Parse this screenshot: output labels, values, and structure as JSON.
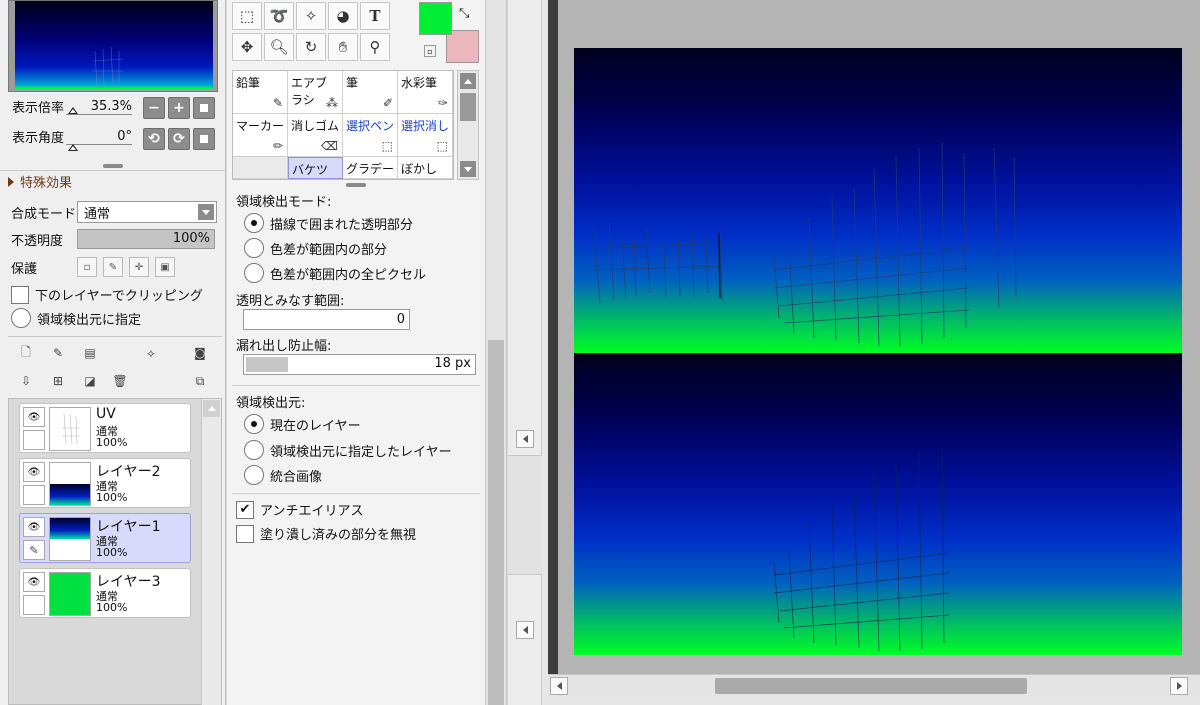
{
  "navigator": {
    "zoom_label": "表示倍率",
    "zoom_value": "35.3%",
    "angle_label": "表示角度",
    "angle_value": "0°",
    "zoom_buttons": [
      "−",
      "+",
      ""
    ],
    "angle_buttons": [
      "⟲",
      "⟳",
      ""
    ]
  },
  "effects": {
    "header": "特殊効果"
  },
  "layer_props": {
    "blend_label": "合成モード",
    "blend_value": "通常",
    "opacity_label": "不透明度",
    "opacity_value": "100%",
    "opacity_fraction": 1.0,
    "protect_label": "保護",
    "clip_label": "下のレイヤーでクリッピング",
    "clip_checked": false,
    "detect_source_label": "領域検出元に指定",
    "detect_source_checked": false
  },
  "layers": [
    {
      "name": "UV",
      "mode": "通常",
      "opacity": "100%",
      "visible": true,
      "selected": false,
      "thumb": "sketch"
    },
    {
      "name": "レイヤー2",
      "mode": "通常",
      "opacity": "100%",
      "visible": true,
      "selected": false,
      "thumb": "gradient-bottom"
    },
    {
      "name": "レイヤー1",
      "mode": "通常",
      "opacity": "100%",
      "visible": true,
      "selected": true,
      "thumb": "gradient-top"
    },
    {
      "name": "レイヤー3",
      "mode": "通常",
      "opacity": "100%",
      "visible": true,
      "selected": false,
      "thumb": "green"
    }
  ],
  "tools": {
    "row1": [
      "rect-select-icon",
      "lasso-icon",
      "magic-wand-icon",
      "select-pen-icon",
      "text-icon"
    ],
    "row2": [
      "move-icon",
      "zoom-icon",
      "rotate-icon",
      "hand-icon",
      "eyedropper-icon"
    ],
    "text_tool_glyph": "T"
  },
  "colors": {
    "main": "#00ee33",
    "sub": "#ebb6bd"
  },
  "brushes": [
    {
      "label": "鉛筆",
      "color": "normal"
    },
    {
      "label": "エアブラシ",
      "color": "normal"
    },
    {
      "label": "筆",
      "color": "normal"
    },
    {
      "label": "水彩筆",
      "color": "normal"
    },
    {
      "label": "マーカー",
      "color": "normal"
    },
    {
      "label": "消しゴム",
      "color": "normal"
    },
    {
      "label": "選択ペン",
      "color": "blue"
    },
    {
      "label": "選択消し",
      "color": "blue"
    },
    {
      "label": "",
      "color": "normal"
    },
    {
      "label": "バケツ",
      "color": "normal"
    },
    {
      "label": "グラデー",
      "color": "normal"
    },
    {
      "label": "ぼかし",
      "color": "normal"
    }
  ],
  "bucket_options": {
    "detect_mode_label": "領域検出モード:",
    "detect_modes": [
      "描線で囲まれた透明部分",
      "色差が範囲内の部分",
      "色差が範囲内の全ピクセル"
    ],
    "detect_mode_selected": 0,
    "transparent_range_label": "透明とみなす範囲:",
    "transparent_range_value": "0",
    "leak_label": "漏れ出し防止幅:",
    "leak_value": "18 px",
    "source_label": "領域検出元:",
    "sources": [
      "現在のレイヤー",
      "領域検出元に指定したレイヤー",
      "統合画像"
    ],
    "source_selected": 0,
    "antialias_label": "アンチエイリアス",
    "antialias_checked": true,
    "ignore_filled_label": "塗り潰し済みの部分を無視",
    "ignore_filled_checked": false
  }
}
